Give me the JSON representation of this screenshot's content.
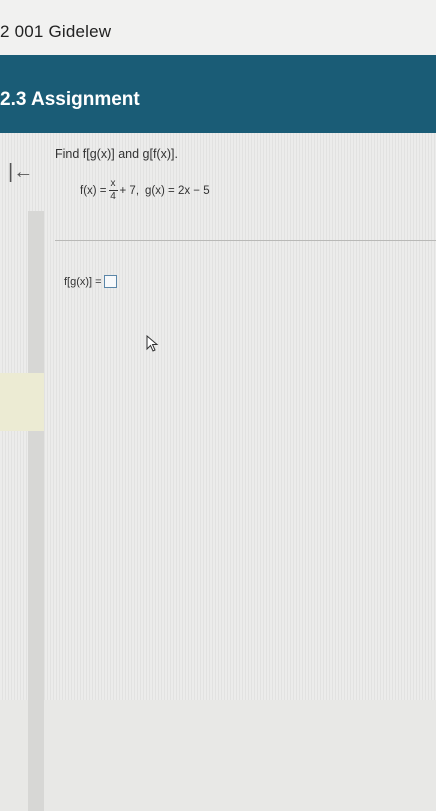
{
  "top_bar": {
    "course_name": "2 001 Gidelew"
  },
  "header": {
    "title": "2.3 Assignment"
  },
  "nav": {
    "collapse_icon": "collapse-left-icon",
    "collapse_glyph": "|←"
  },
  "question": {
    "prompt": "Find f[g(x)] and g[f(x)].",
    "f_lhs": "f(x) =",
    "f_numerator": "x",
    "f_denominator": "4",
    "f_rest": "+ 7,",
    "g_def": "g(x) = 2x − 5"
  },
  "answer": {
    "label": "f[g(x)] =",
    "value": ""
  },
  "icons": {
    "pointer": "mouse-pointer-icon"
  }
}
